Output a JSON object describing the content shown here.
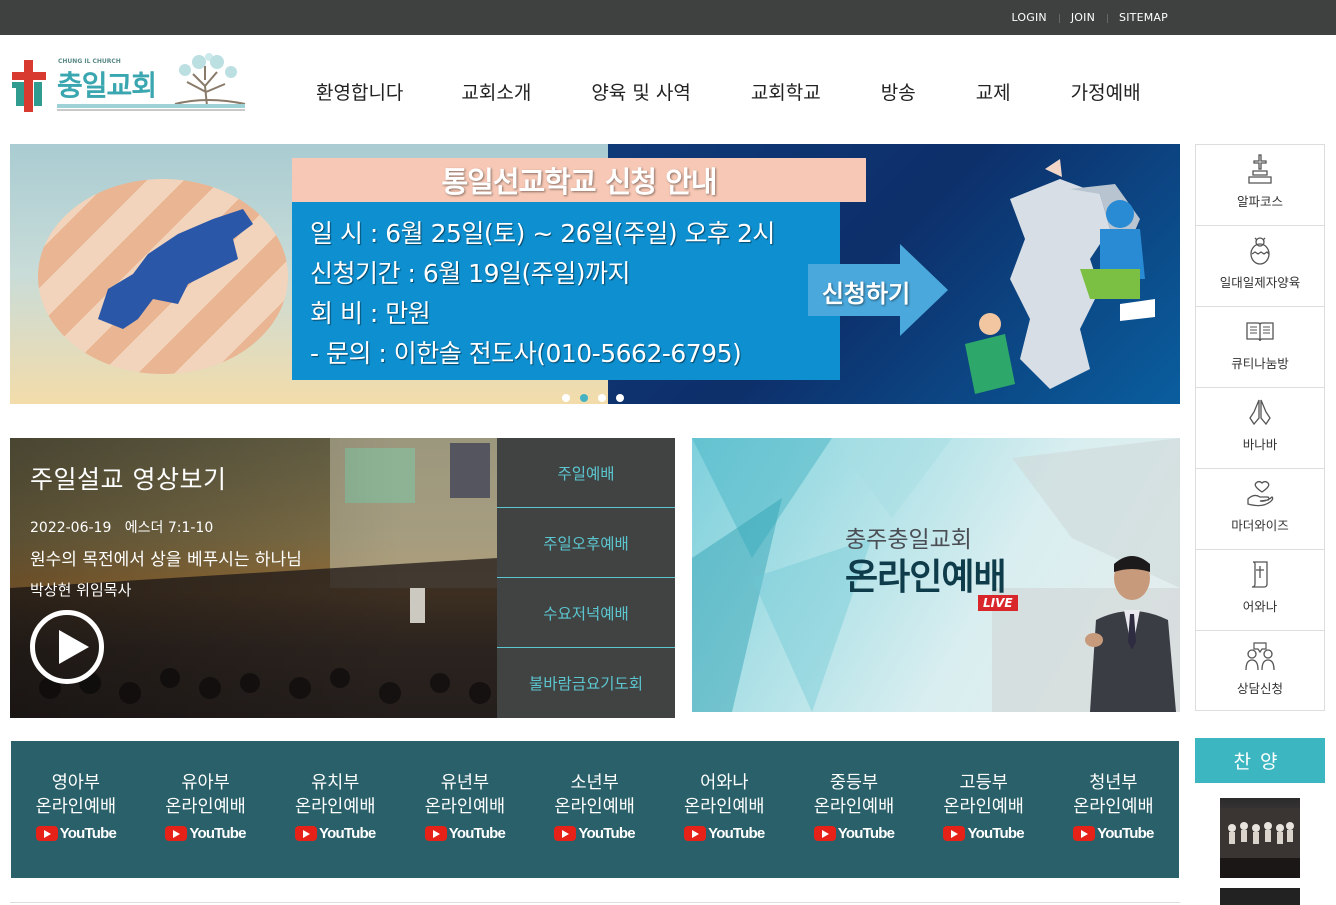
{
  "topbar": {
    "login": "LOGIN",
    "join": "JOIN",
    "sitemap": "SITEMAP"
  },
  "logo": {
    "english": "CHUNG IL CHURCH",
    "korean": "충일교회"
  },
  "nav": [
    "환영합니다",
    "교회소개",
    "양육 및 사역",
    "교회학교",
    "방송",
    "교제",
    "가정예배"
  ],
  "banner": {
    "title": "통일선교학교 신청 안내",
    "lines": [
      "일      시 : 6월 25일(토) ~ 26일(주일) 오후 2시",
      "신청기간 : 6월 19일(주일)까지",
      "회      비 : 만원",
      "- 문의 : 이한솔 전도사(010-5662-6795)"
    ],
    "cta": "신청하기",
    "slide_count": 4,
    "active_slide": 2
  },
  "quick_menu": [
    {
      "label": "알파코스",
      "icon": "church-cross-icon"
    },
    {
      "label": "일대일제자양육",
      "icon": "chick-icon"
    },
    {
      "label": "큐티나눔방",
      "icon": "open-book-icon"
    },
    {
      "label": "바나바",
      "icon": "praying-hands-icon"
    },
    {
      "label": "마더와이즈",
      "icon": "heart-hand-icon"
    },
    {
      "label": "어와나",
      "icon": "scroll-cross-icon"
    },
    {
      "label": "상담신청",
      "icon": "counsel-people-icon"
    }
  ],
  "sermon": {
    "title": "주일설교 영상보기",
    "date": "2022-06-19",
    "scripture": "에스더 7:1-10",
    "subject": "원수의 목전에서 상을 베푸시는 하나님",
    "pastor": "박상현 위임목사",
    "tabs": [
      "주일예배",
      "주일오후예배",
      "수요저녁예배",
      "불바람금요기도회"
    ]
  },
  "online": {
    "church": "충주충일교회",
    "headline": "온라인예배",
    "badge": "LIVE"
  },
  "departments": [
    {
      "name": "영아부",
      "sub": "온라인예배",
      "yt": "YouTube"
    },
    {
      "name": "유아부",
      "sub": "온라인예배",
      "yt": "YouTube"
    },
    {
      "name": "유치부",
      "sub": "온라인예배",
      "yt": "YouTube"
    },
    {
      "name": "유년부",
      "sub": "온라인예배",
      "yt": "YouTube"
    },
    {
      "name": "소년부",
      "sub": "온라인예배",
      "yt": "YouTube"
    },
    {
      "name": "어와나",
      "sub": "온라인예배",
      "yt": "YouTube"
    },
    {
      "name": "중등부",
      "sub": "온라인예배",
      "yt": "YouTube"
    },
    {
      "name": "고등부",
      "sub": "온라인예배",
      "yt": "YouTube"
    },
    {
      "name": "청년부",
      "sub": "온라인예배",
      "yt": "YouTube"
    }
  ],
  "praise": {
    "title": "찬양"
  },
  "colors": {
    "topbar": "#3f4141",
    "accent": "#3cb7c2",
    "dept_bg": "#2a6069",
    "tab_bg": "#414343",
    "tab_text": "#5bc6cf",
    "youtube_red": "#e62117"
  }
}
